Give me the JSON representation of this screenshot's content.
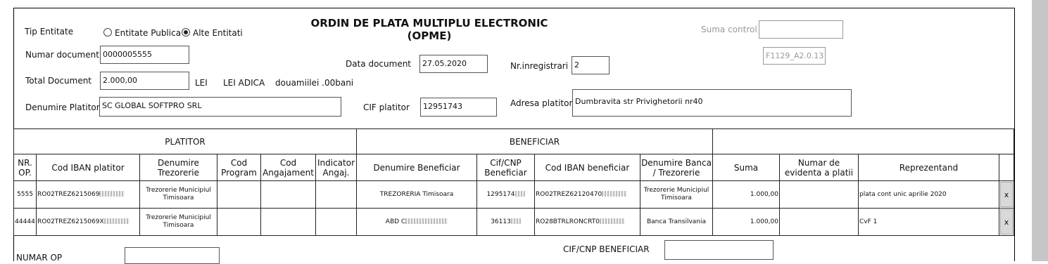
{
  "form": {
    "title_line1": "ORDIN DE PLATA MULTIPLU ELECTRONIC",
    "title_line2": "(OPME)",
    "tip_entitate_label": "Tip Entitate",
    "option_publica": "Entitate Publica",
    "option_alte": "Alte Entitati",
    "selected_option": "Alte Entitati",
    "numar_document_label": "Numar document",
    "numar_document": "0000005555",
    "total_document_label": "Total Document",
    "total_document": "2.000,00",
    "currency": "LEI",
    "lei_adica_label": "LEI ADICA",
    "amount_words": "douamiilei .00bani",
    "data_document_label": "Data document",
    "data_document": "27.05.2020",
    "nr_inregistrari_label": "Nr.inregistrari",
    "nr_inregistrari": "2",
    "suma_control_label": "Suma control",
    "suma_control": "",
    "form_code": "F1129_A2.0.13",
    "denumire_platitor_label": "Denumire Platitor",
    "denumire_platitor": "SC GLOBAL SOFTPRO SRL",
    "cif_platitor_label": "CIF platitor",
    "cif_platitor": "12951743",
    "adresa_platitor_label": "Adresa platitor",
    "adresa_platitor": "Dumbravita str Privighetorii nr40"
  },
  "table": {
    "section_platitor": "PLATITOR",
    "section_beneficiar": "BENEFICIAR",
    "headers": [
      "NR. OP.",
      "Cod IBAN platitor",
      "Denumire Trezorerie",
      "Cod Program",
      "Cod Angajament",
      "Indicator Angaj.",
      "Denumire Beneficiar",
      "Cif/CNP Beneficiar",
      "Cod IBAN beneficiar",
      "Denumire Banca / Trezorerie",
      "Suma",
      "Numar de evidenta a platii",
      "Reprezentand"
    ],
    "rows": [
      {
        "nr_op": "5555",
        "iban_platitor": "RO02TREZ6215069",
        "trezorerie": "Trezorerie Municipiul Timisoara",
        "cod_program": "",
        "cod_angajament": "",
        "indicator": "",
        "beneficiar": "TREZORERIA Timisoara",
        "cif_beneficiar": "1295174",
        "iban_beneficiar": "RO02TREZ62120470",
        "banca": "Trezorerie Municipiul Timisoara",
        "suma": "1.000,00",
        "numar_evidenta": "",
        "reprezentand": "plata cont unic aprilie 2020",
        "delete": "x"
      },
      {
        "nr_op": "44444",
        "iban_platitor": "RO02TREZ6215069X",
        "trezorerie": "Trezorerie Municipiul Timisoara",
        "cod_program": "",
        "cod_angajament": "",
        "indicator": "",
        "beneficiar": "ABD C",
        "cif_beneficiar": "36113",
        "iban_beneficiar": "RO28BTRLRONCRT0",
        "banca": "Banca Transilvania",
        "suma": "1.000,00",
        "numar_evidenta": "",
        "reprezentand": "CvF 1",
        "delete": "x"
      }
    ]
  },
  "filters": {
    "numar_op_label": "NUMAR OP",
    "numar_op": "",
    "cif_beneficiar_label": "CIF/CNP BENEFICIAR",
    "cif_beneficiar": ""
  }
}
